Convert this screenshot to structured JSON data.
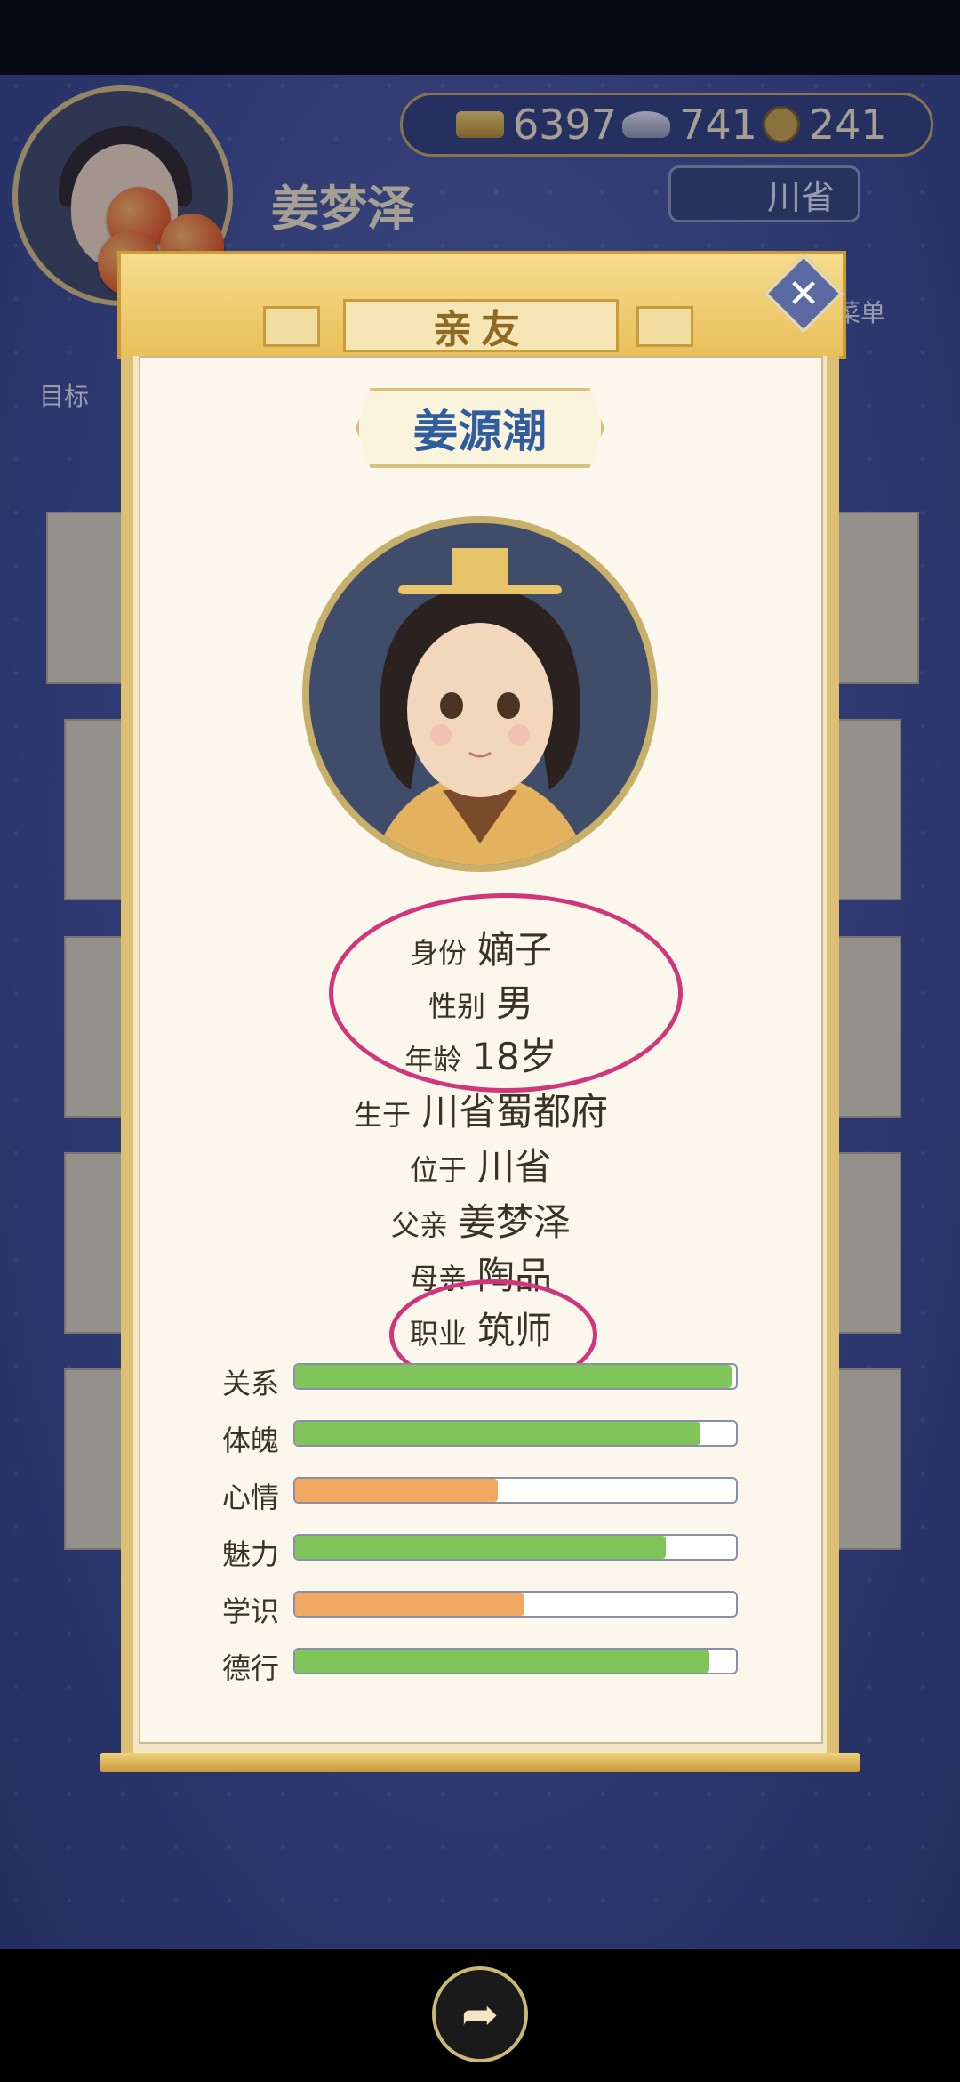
{
  "header": {
    "player_name": "姜梦泽",
    "province": "川省",
    "menu_label": "菜单",
    "goal_label": "目标",
    "resources": [
      {
        "icon": "gold-ingot-icon",
        "value": "6397"
      },
      {
        "icon": "silver-ingot-icon",
        "value": "741"
      },
      {
        "icon": "copper-coin-icon",
        "value": "241"
      }
    ]
  },
  "modal": {
    "tab_title": "亲友",
    "close_icon": "close-icon",
    "person_name": "姜源潮",
    "info": [
      {
        "key": "身份",
        "value": "嫡子"
      },
      {
        "key": "性别",
        "value": "男"
      },
      {
        "key": "年龄",
        "value": "18岁"
      },
      {
        "key": "生于",
        "value": "川省蜀都府"
      },
      {
        "key": "位于",
        "value": "川省"
      },
      {
        "key": "父亲",
        "value": "姜梦泽"
      },
      {
        "key": "母亲",
        "value": "陶品"
      },
      {
        "key": "职业",
        "value": "筑师"
      }
    ],
    "stats": [
      {
        "label": "关系",
        "fraction": 0.99,
        "color": "#7fc55a"
      },
      {
        "label": "体魄",
        "fraction": 0.92,
        "color": "#7fc55a"
      },
      {
        "label": "心情",
        "fraction": 0.46,
        "color": "#f0a862"
      },
      {
        "label": "魅力",
        "fraction": 0.84,
        "color": "#7fc55a"
      },
      {
        "label": "学识",
        "fraction": 0.52,
        "color": "#f0a862"
      },
      {
        "label": "德行",
        "fraction": 0.94,
        "color": "#7fc55a"
      }
    ]
  },
  "footer": {
    "share_icon": "share-icon"
  }
}
